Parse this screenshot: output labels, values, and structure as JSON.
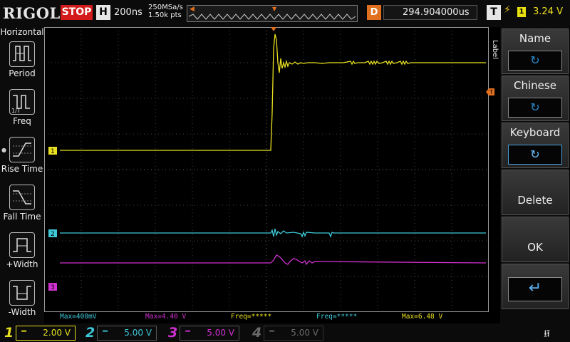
{
  "header": {
    "logo": "RIGOL",
    "run_status": "STOP",
    "horizontal_badge": "H",
    "timebase": "200ns",
    "sample_rate": "250MSa/s",
    "memory_depth": "1.50k pts",
    "delay_badge": "D",
    "delay_value": "294.904000us",
    "trigger_badge": "T",
    "trigger_source": "1",
    "trigger_level": "3.24 V"
  },
  "left_menu": {
    "title": "Horizontal",
    "items": [
      {
        "label": "Period",
        "icon": "period-icon"
      },
      {
        "label": "Freq",
        "icon": "frequency-icon"
      },
      {
        "label": "Rise Time",
        "icon": "rise-time-icon",
        "selected": true
      },
      {
        "label": "Fall Time",
        "icon": "fall-time-icon"
      },
      {
        "label": "+Width",
        "icon": "positive-width-icon"
      },
      {
        "label": "-Width",
        "icon": "negative-width-icon"
      }
    ]
  },
  "measurements": [
    {
      "text": "Max=400mV",
      "color": "#3ec8d8"
    },
    {
      "text": "Max=4.40 V",
      "color": "#d030d0"
    },
    {
      "text": "Freq=*****",
      "color": "#e8e020"
    },
    {
      "text": "Freq=*****",
      "color": "#3ec8d8"
    },
    {
      "text": "Max=6.48 V",
      "color": "#e8e020"
    }
  ],
  "channel_markers": [
    "1",
    "2",
    "3"
  ],
  "trigger_marker": "T",
  "right_menu": {
    "tab": "Label",
    "keys": [
      {
        "label": "Name",
        "icon": "rotate-knob-icon"
      },
      {
        "label": "Chinese",
        "icon": "rotate-knob-icon"
      },
      {
        "label": "Keyboard",
        "icon": "rotate-knob-icon",
        "active": true
      },
      {
        "label": "Delete"
      },
      {
        "label": "OK"
      },
      {
        "label": "",
        "icon": "enter-icon"
      }
    ]
  },
  "channels": [
    {
      "num": "1",
      "coupling": "=",
      "scale": "2.00 V",
      "color": "#e8e020",
      "enabled": true
    },
    {
      "num": "2",
      "coupling": "=",
      "scale": "5.00 V",
      "color": "#3ec8d8",
      "enabled": true
    },
    {
      "num": "3",
      "coupling": "=",
      "scale": "5.00 V",
      "color": "#d030d0",
      "enabled": true
    },
    {
      "num": "4",
      "coupling": "=",
      "scale": "5.00 V",
      "color": "#6a6a6a",
      "enabled": false
    }
  ],
  "colors": {
    "ch1": "#e8e020",
    "ch2": "#3ec8d8",
    "ch3": "#d030d0",
    "ch4": "#6a6a6a",
    "trigger": "#e07020",
    "stop": "#d31b1b"
  }
}
